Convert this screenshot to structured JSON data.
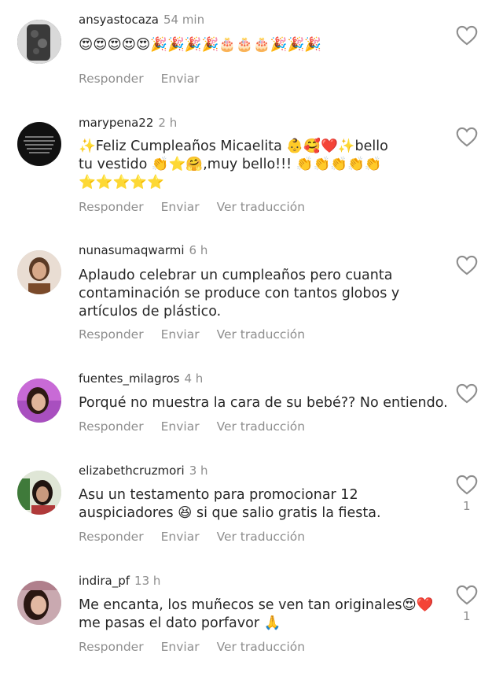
{
  "comments": [
    {
      "username": "ansyastocaza",
      "time": "54 min",
      "text": "😍😍😍😍😍🎉🎉🎉🎉🎂🎂🎂🎉🎉🎉",
      "reply_label": "Responder",
      "send_label": "Enviar",
      "translate_label": "",
      "likes": ""
    },
    {
      "username": "marypena22",
      "time": "2 h",
      "text": "✨Feliz Cumpleaños Micaelita 👶🥰❤️✨bello tu vestido 👏⭐🤗,muy bello!!! 👏👏👏👏👏⭐⭐⭐⭐⭐",
      "reply_label": "Responder",
      "send_label": "Enviar",
      "translate_label": "Ver traducción",
      "likes": ""
    },
    {
      "username": "nunasumaqwarmi",
      "time": "6 h",
      "text": "Aplaudo celebrar un cumpleaños pero cuanta contaminación se produce con tantos globos y artículos de plástico.",
      "reply_label": "Responder",
      "send_label": "Enviar",
      "translate_label": "Ver traducción",
      "likes": ""
    },
    {
      "username": "fuentes_milagros",
      "time": "4 h",
      "text": "Porqué no muestra la cara de su bebé?? No entiendo.",
      "reply_label": "Responder",
      "send_label": "Enviar",
      "translate_label": "Ver traducción",
      "likes": ""
    },
    {
      "username": "elizabethcruzmori",
      "time": "3 h",
      "text": "Asu un testamento para promocionar 12 auspiciadores 😆 si que salio gratis la fiesta.",
      "reply_label": "Responder",
      "send_label": "Enviar",
      "translate_label": "Ver traducción",
      "likes": "1"
    },
    {
      "username": "indira_pf",
      "time": "13 h",
      "text": "Me encanta, los muñecos se ven tan originales😍❤️ me pasas el dato porfavor 🙏",
      "reply_label": "Responder",
      "send_label": "Enviar",
      "translate_label": "Ver traducción",
      "likes": "1"
    }
  ],
  "colors": {
    "text": "#262626",
    "secondary": "#8e8e8e",
    "background": "#ffffff"
  },
  "icons": {
    "like": "heart-outline-icon"
  }
}
